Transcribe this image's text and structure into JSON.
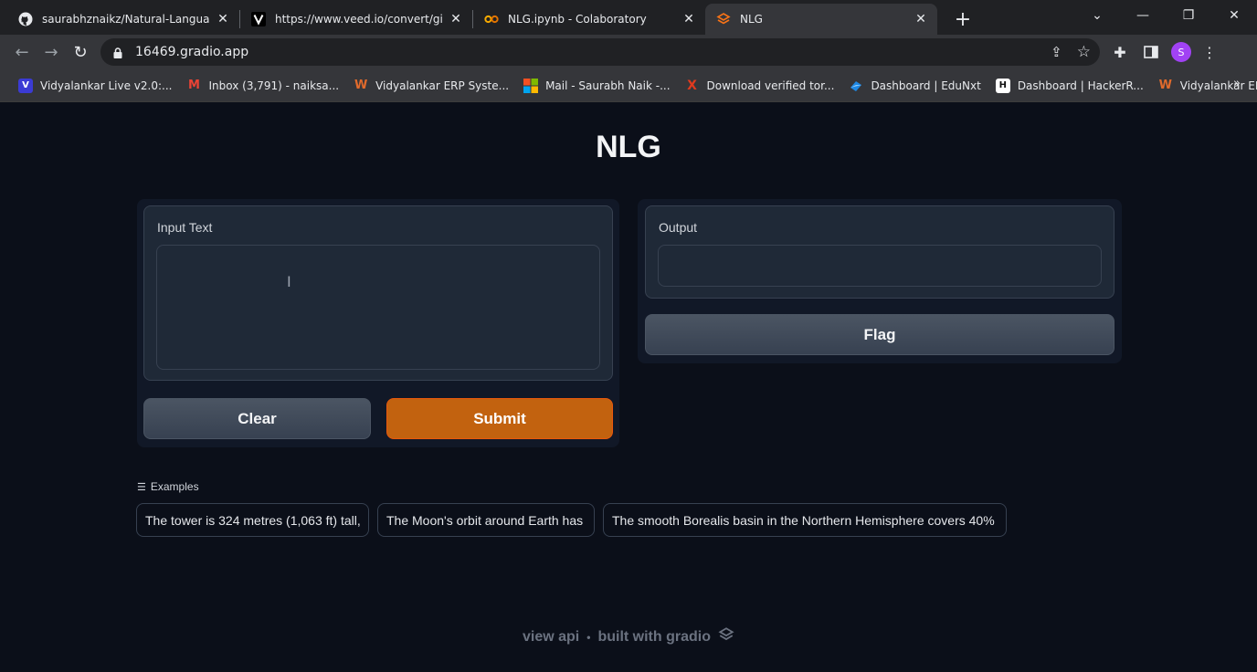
{
  "browser": {
    "tabs": [
      {
        "label": "saurabhznaikz/Natural-Language-Ge",
        "icon": "github-icon"
      },
      {
        "label": "https://www.veed.io/convert/gif-cor",
        "icon": "veed-icon"
      },
      {
        "label": "NLG.ipynb - Colaboratory",
        "icon": "colab-icon"
      },
      {
        "label": "NLG",
        "icon": "gradio-icon"
      }
    ],
    "url": "16469.gradio.app",
    "avatar_letter": "S",
    "bookmarks": [
      {
        "label": "Vidyalankar Live v2.0:...",
        "color": "#3b3bd4",
        "glyph": "V"
      },
      {
        "label": "Inbox (3,791) - naiksa...",
        "color": "#ea4335",
        "glyph": "M"
      },
      {
        "label": "Vidyalankar ERP Syste...",
        "color": "#e06a2c",
        "glyph": "W"
      },
      {
        "label": "Mail - Saurabh Naik -...",
        "color": "#0078d4",
        "glyph": ""
      },
      {
        "label": "Download verified tor...",
        "color": "#e03a1e",
        "glyph": "X"
      },
      {
        "label": "Dashboard | EduNxt",
        "color": "#1e88e5",
        "glyph": ""
      },
      {
        "label": "Dashboard | HackerR...",
        "color": "#111111",
        "glyph": "H"
      },
      {
        "label": "Vidyalankar ERP Syste...",
        "color": "#e06a2c",
        "glyph": "W"
      }
    ],
    "more": "»"
  },
  "app": {
    "title": "NLG",
    "input_label": "Input Text",
    "input_value": "",
    "output_label": "Output",
    "output_value": "",
    "clear_label": "Clear",
    "submit_label": "Submit",
    "flag_label": "Flag",
    "examples_label": "Examples",
    "examples": [
      "The tower is 324 metres (1,063 ft) tall,",
      "The Moon's orbit around Earth has",
      "The smooth Borealis basin in the Northern Hemisphere covers 40%"
    ],
    "footer_api": "view api",
    "footer_dot": "•",
    "footer_built": "built with gradio"
  },
  "colors": {
    "accent": "#c2620f",
    "background": "#0b0f19"
  }
}
